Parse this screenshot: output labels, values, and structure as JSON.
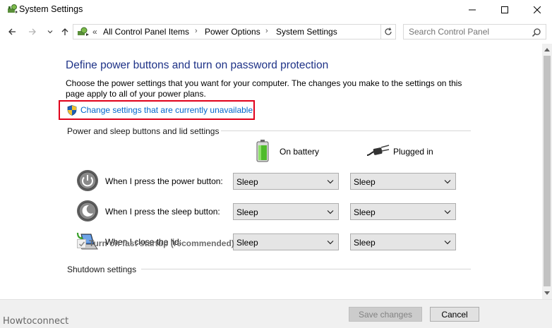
{
  "window": {
    "title": "System Settings",
    "minimize_glyph": "minimize-icon",
    "maximize_glyph": "maximize-icon",
    "close_glyph": "close-icon"
  },
  "address_bar": {
    "prefix": "«",
    "breadcrumbs": [
      "All Control Panel Items",
      "Power Options",
      "System Settings"
    ],
    "separator": "›"
  },
  "search": {
    "placeholder": "Search Control Panel",
    "value": ""
  },
  "main": {
    "title": "Define power buttons and turn on password protection",
    "description": "Choose the power settings that you want for your computer. The changes you make to the settings on this page apply to all of your power plans.",
    "change_link": "Change settings that are currently unavailable",
    "section_buttons": "Power and sleep buttons and lid settings",
    "columns": {
      "battery": "On battery",
      "plugged": "Plugged in"
    },
    "rows": [
      {
        "label": "When I press the power button:",
        "battery": "Sleep",
        "plugged": "Sleep",
        "icon": "power-button-icon"
      },
      {
        "label": "When I press the sleep button:",
        "battery": "Sleep",
        "plugged": "Sleep",
        "icon": "sleep-button-icon"
      },
      {
        "label": "When I close the lid:",
        "battery": "Sleep",
        "plugged": "Sleep",
        "icon": "laptop-lid-icon"
      }
    ],
    "section_shutdown": "Shutdown settings",
    "fast_startup": {
      "label": "Turn on fast startup (recommended)",
      "checked": true
    }
  },
  "footer": {
    "save": "Save changes",
    "cancel": "Cancel"
  },
  "watermark": "Howtoconnect",
  "colors": {
    "title": "#1e3287",
    "link": "#0066cc",
    "highlight_border": "#e0001b"
  }
}
